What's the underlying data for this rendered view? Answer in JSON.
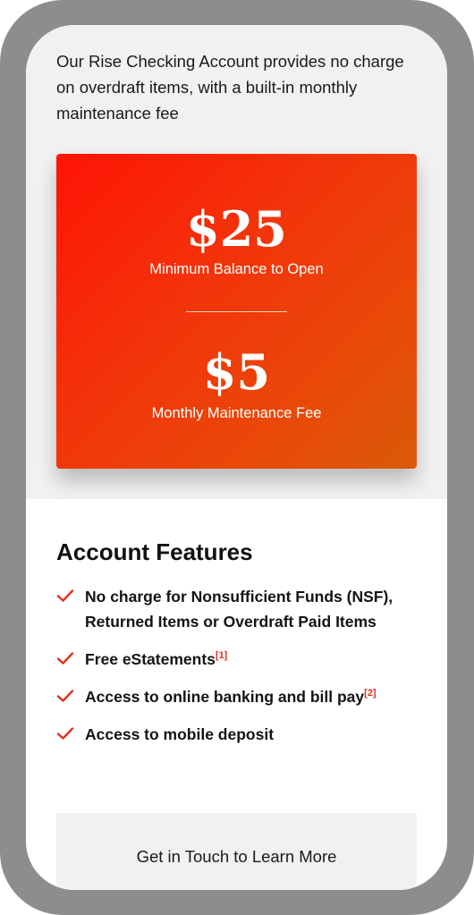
{
  "intro": {
    "text": "Our Rise Checking Account provides no charge on overdraft items, with a built-in monthly maintenance fee"
  },
  "pricing": {
    "minimum_balance": {
      "amount": "$25",
      "label": "Minimum Balance to Open"
    },
    "monthly_fee": {
      "amount": "$5",
      "label": "Monthly Maintenance Fee"
    }
  },
  "features": {
    "title": "Account Features",
    "items": [
      {
        "text": "No charge for Nonsufficient Funds (NSF), Returned Items or Overdraft Paid Items",
        "ref": ""
      },
      {
        "text": "Free eStatements",
        "ref": "[1]"
      },
      {
        "text": "Access to online banking and bill pay",
        "ref": "[2]"
      },
      {
        "text": "Access to mobile deposit",
        "ref": ""
      }
    ]
  },
  "cta": {
    "label": "Get in Touch to Learn More"
  },
  "colors": {
    "accent": "#e0301e",
    "card_gradient_start": "#ff1405",
    "card_gradient_end": "#d95a08",
    "hero_background": "#f1f1f1",
    "device_frame": "#8d8d8f"
  },
  "icons": {
    "feature_bullet": "checkmark-icon"
  }
}
